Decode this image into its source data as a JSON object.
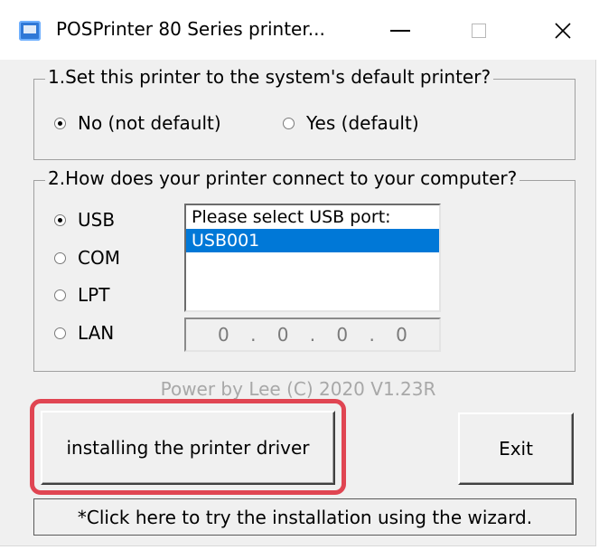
{
  "window": {
    "title": "POSPrinter 80 Series printer...",
    "icon": "printer-app-icon",
    "controls": {
      "minimize": "minimize-icon",
      "maximize": "maximize-icon",
      "close": "close-icon"
    }
  },
  "section1": {
    "title": "1.Set this printer to the system's default printer?",
    "options": [
      {
        "label": "No (not default)",
        "checked": true
      },
      {
        "label": "Yes (default)",
        "checked": false
      }
    ]
  },
  "section2": {
    "title": "2.How does your printer connect to your computer?",
    "options": [
      {
        "label": "USB",
        "checked": true
      },
      {
        "label": "COM",
        "checked": false
      },
      {
        "label": "LPT",
        "checked": false
      },
      {
        "label": "LAN",
        "checked": false
      }
    ],
    "port_list": {
      "header": "Please select USB port:",
      "items": [
        "USB001"
      ],
      "selected": "USB001"
    },
    "ip_address": [
      "0",
      "0",
      "0",
      "0"
    ],
    "ip_separator": "."
  },
  "credit": "Power by Lee  (C) 2020  V1.23R",
  "buttons": {
    "install": "installing the printer driver",
    "exit": "Exit"
  },
  "wizard_link": "*Click here to try the installation using the wizard.",
  "colors": {
    "highlight": "#e04552",
    "selection": "#0078d7",
    "dialog_bg": "#f0f0f0"
  }
}
